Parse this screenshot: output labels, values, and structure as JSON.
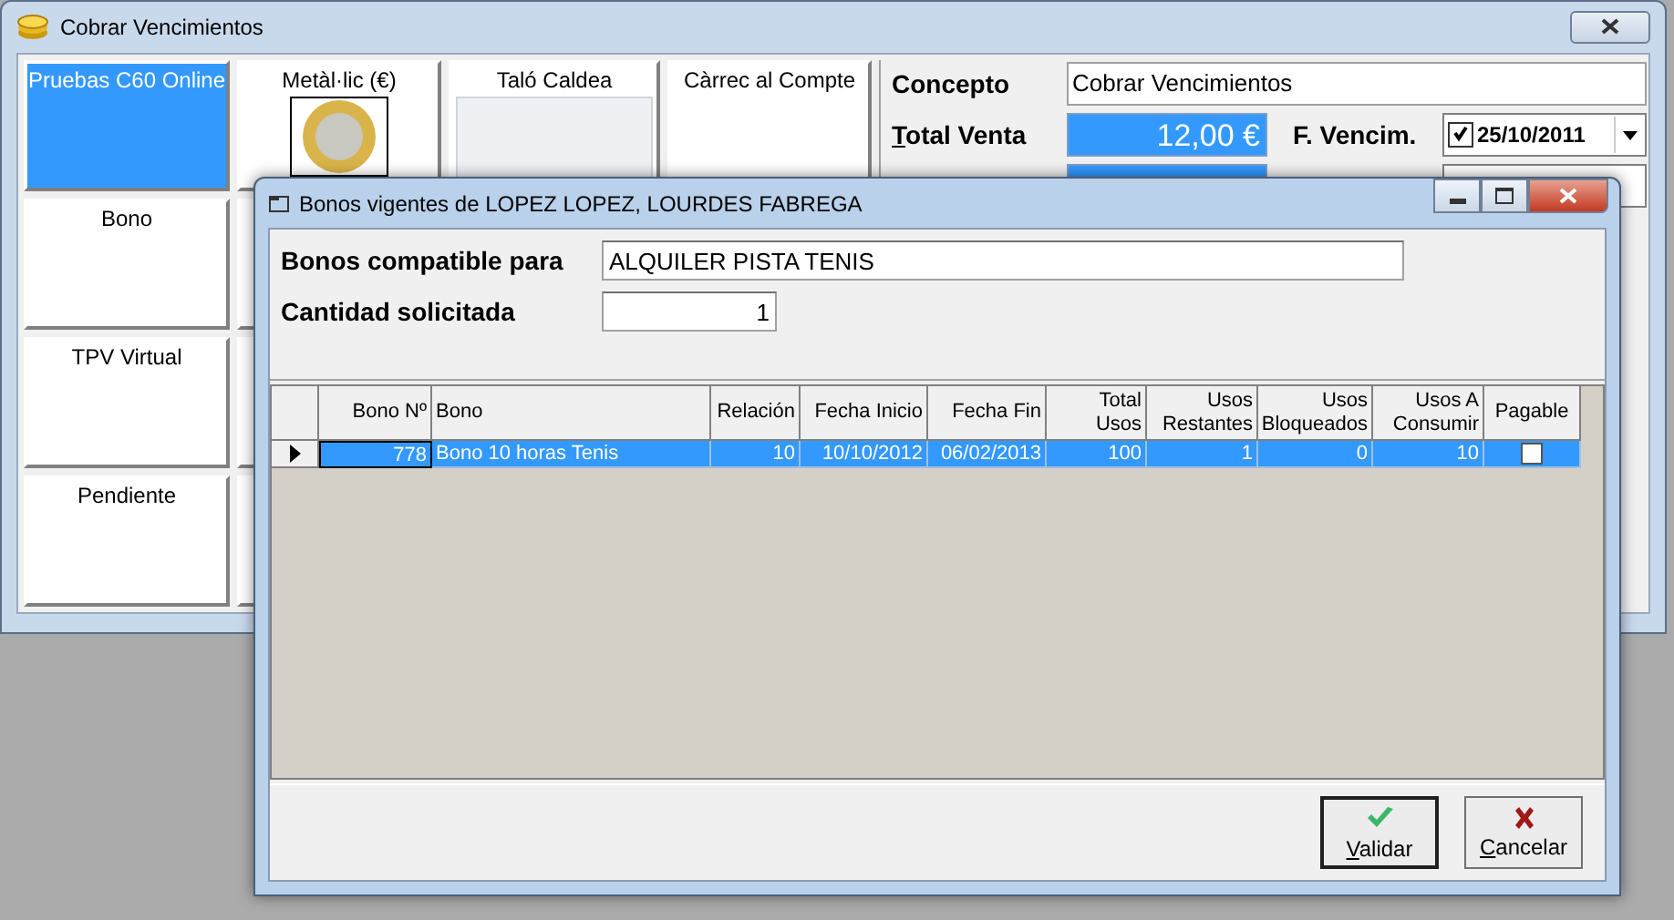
{
  "main_window": {
    "title": "Cobrar Vencimientos"
  },
  "payment_column": [
    {
      "label": "Pruebas C60 Online",
      "selected": true
    },
    {
      "label": "Bono",
      "selected": false
    },
    {
      "label": "TPV Virtual",
      "selected": false
    },
    {
      "label": "Pendiente",
      "selected": false
    }
  ],
  "payment_row": [
    {
      "label": "Metàl·lic (€)",
      "kind": "coin",
      "selected": false
    },
    {
      "label": "Taló Caldea",
      "kind": "cheque",
      "selected": false
    },
    {
      "label": "Càrrec al Compte",
      "kind": "plain",
      "selected": false
    }
  ],
  "form": {
    "concepto": {
      "label": "Concepto",
      "value": "Cobrar Vencimientos"
    },
    "total_venta": {
      "label": "Total Venta",
      "value": "12,00 €"
    },
    "f_vencim": {
      "label": "F. Vencim.",
      "value": "25/10/2011",
      "checked": true
    }
  },
  "dialog": {
    "title": "Bonos vigentes de LOPEZ LOPEZ, LOURDES FABREGA",
    "compatible": {
      "label": "Bonos compatible para",
      "value": "ALQUILER PISTA TENIS"
    },
    "cantidad": {
      "label": "Cantidad solicitada",
      "value": "1"
    },
    "table": {
      "columns": [
        "Bono Nº",
        "Bono",
        "Relación",
        "Fecha Inicio",
        "Fecha Fin",
        "Total Usos",
        "Usos Restantes",
        "Usos Bloqueados",
        "Usos A Consumir",
        "Pagable"
      ],
      "rows": [
        {
          "cells": [
            "778",
            "Bono 10 horas Tenis",
            "10",
            "10/10/2012",
            "06/02/2013",
            "100",
            "1",
            "0",
            "10"
          ],
          "pagable": false,
          "selected": true
        }
      ]
    },
    "buttons": [
      {
        "label": "Validar",
        "kind": "validate"
      },
      {
        "label": "Cancelar",
        "kind": "cancel"
      }
    ]
  }
}
